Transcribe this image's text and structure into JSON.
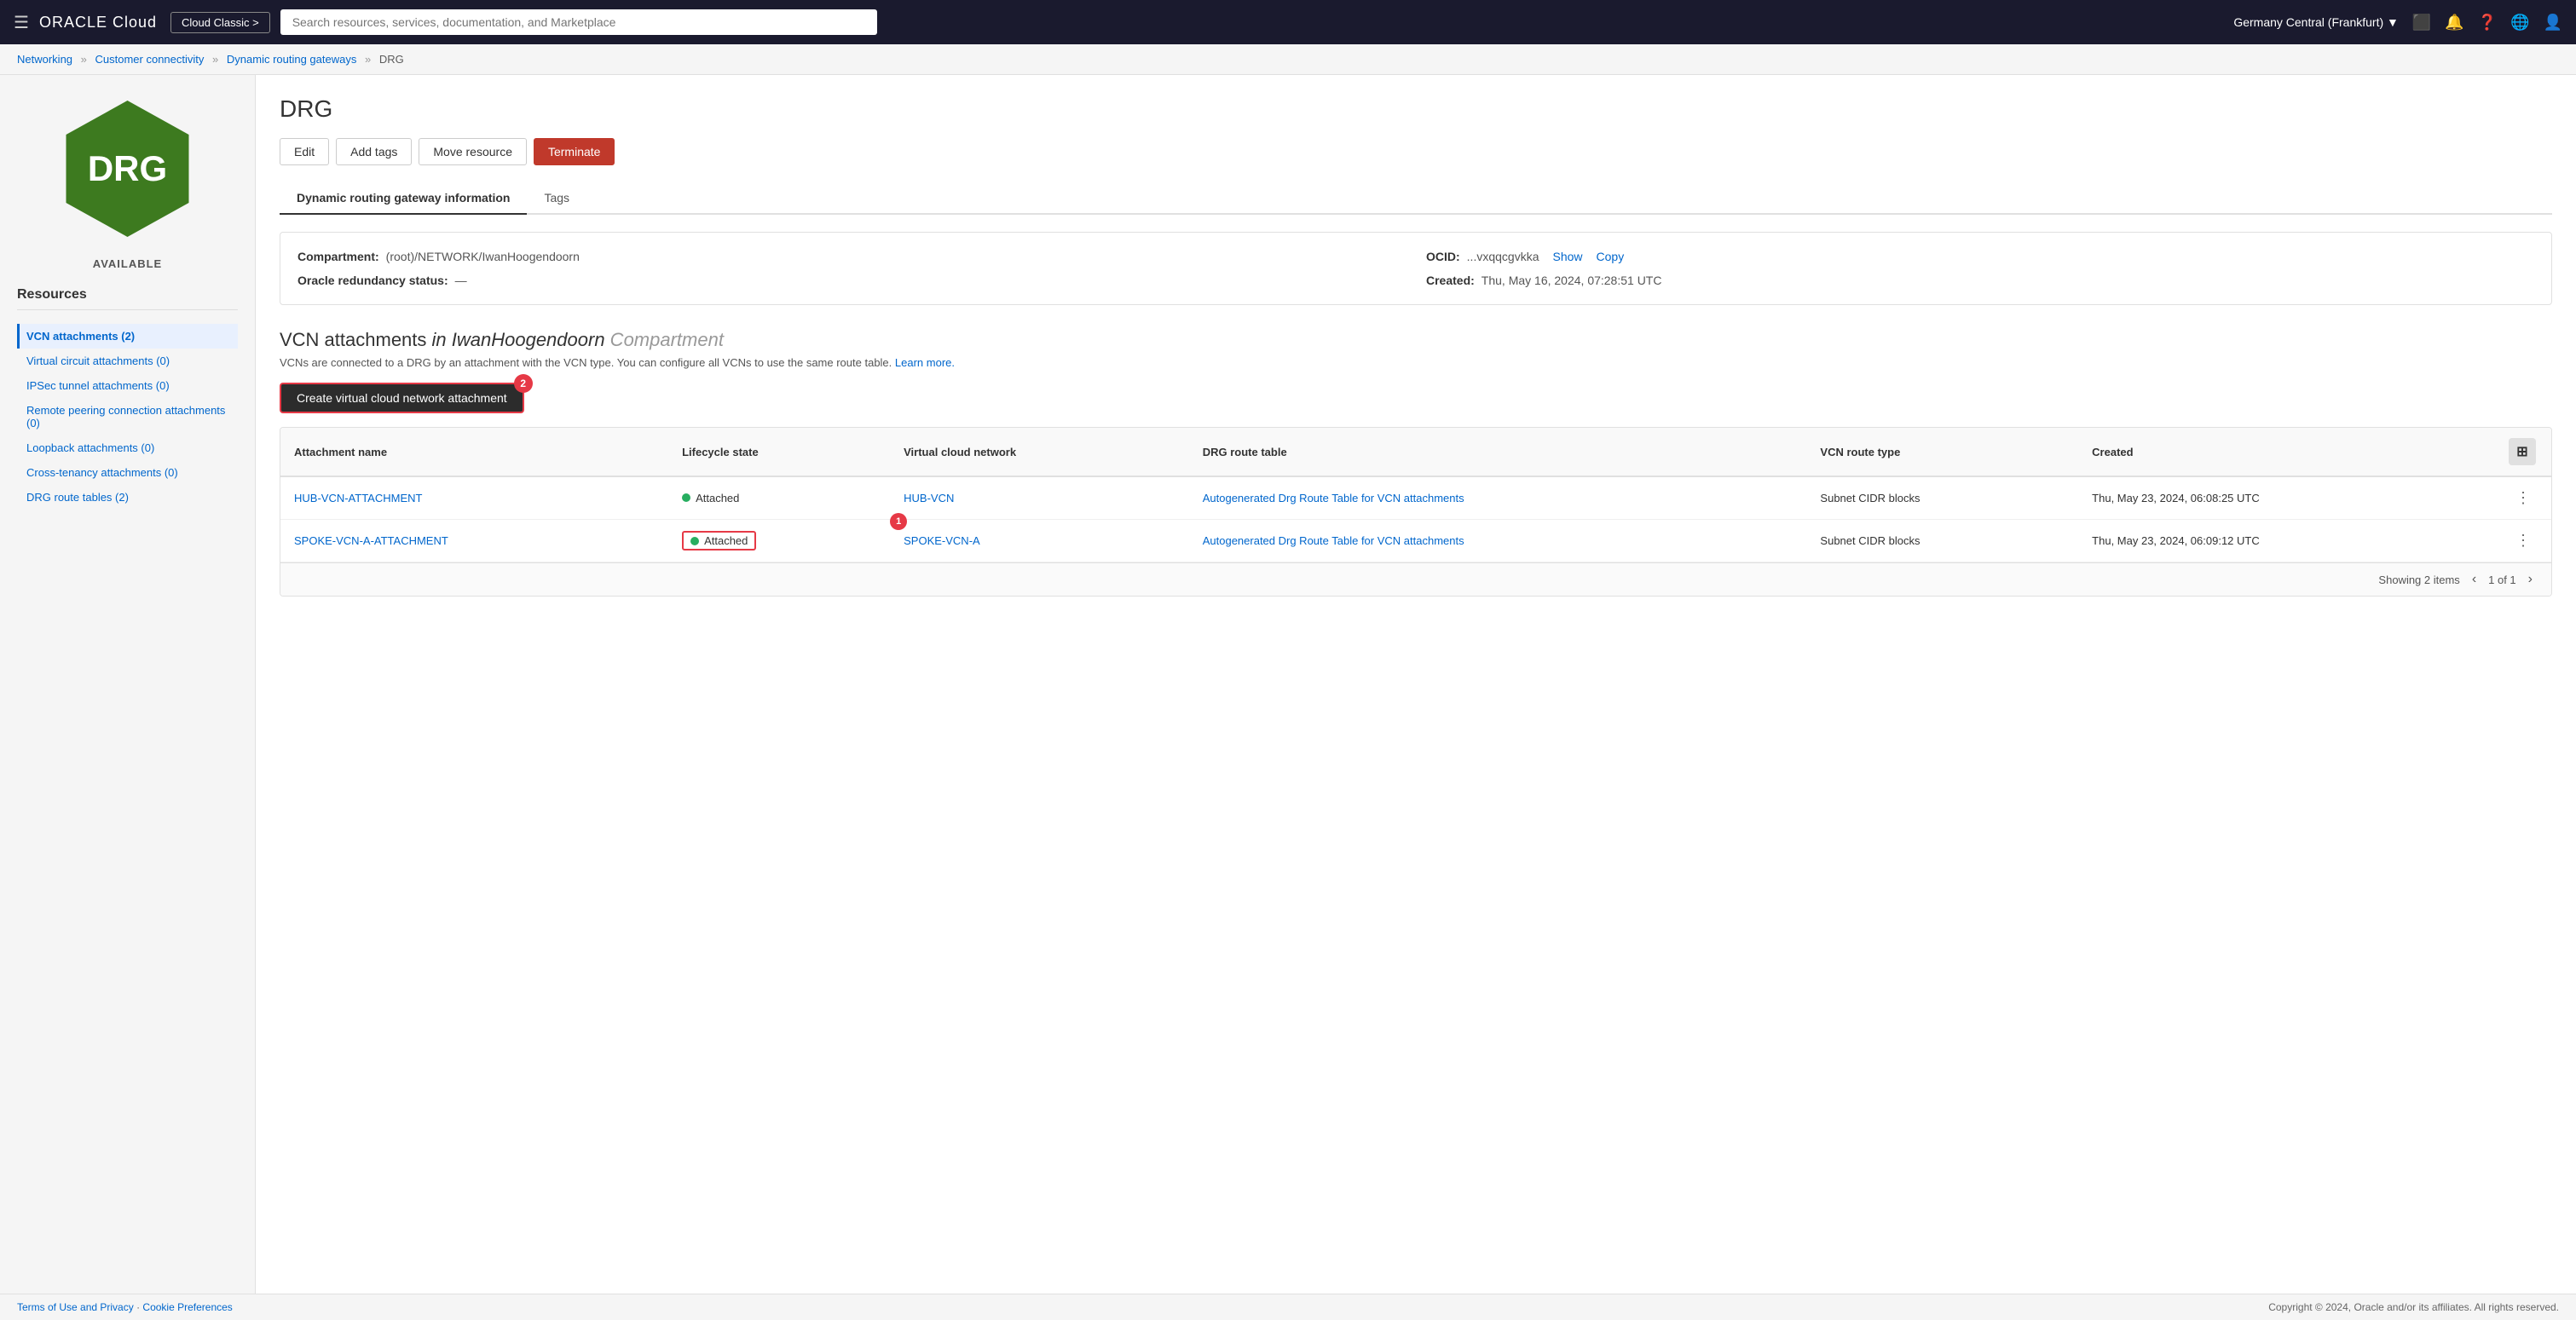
{
  "nav": {
    "hamburger": "☰",
    "logo_oracle": "ORACLE",
    "logo_cloud": " Cloud",
    "cloud_classic_label": "Cloud Classic >",
    "search_placeholder": "Search resources, services, documentation, and Marketplace",
    "region": "Germany Central (Frankfurt)",
    "region_arrow": "▼"
  },
  "breadcrumb": {
    "networking": "Networking",
    "customer_connectivity": "Customer connectivity",
    "dynamic_routing_gateways": "Dynamic routing gateways",
    "current": "DRG"
  },
  "left_panel": {
    "icon_text": "DRG",
    "status_label": "AVAILABLE",
    "resources_title": "Resources",
    "sidebar_items": [
      {
        "label": "VCN attachments (2)",
        "active": true
      },
      {
        "label": "Virtual circuit attachments (0)",
        "active": false
      },
      {
        "label": "IPSec tunnel attachments (0)",
        "active": false
      },
      {
        "label": "Remote peering connection attachments (0)",
        "active": false
      },
      {
        "label": "Loopback attachments (0)",
        "active": false
      },
      {
        "label": "Cross-tenancy attachments (0)",
        "active": false
      },
      {
        "label": "DRG route tables (2)",
        "active": false
      }
    ]
  },
  "content": {
    "page_title": "DRG",
    "buttons": {
      "edit": "Edit",
      "add_tags": "Add tags",
      "move_resource": "Move resource",
      "terminate": "Terminate"
    },
    "tabs": [
      {
        "label": "Dynamic routing gateway information",
        "active": true
      },
      {
        "label": "Tags",
        "active": false
      }
    ],
    "info": {
      "compartment_label": "Compartment:",
      "compartment_value": "(root)/NETWORK/IwanHoogendoorn",
      "ocid_label": "OCID:",
      "ocid_value": "...vxqqcgvkka",
      "ocid_show": "Show",
      "ocid_copy": "Copy",
      "redundancy_label": "Oracle redundancy status:",
      "redundancy_value": "—",
      "created_label": "Created:",
      "created_value": "Thu, May 16, 2024, 07:28:51 UTC"
    },
    "vcn_section": {
      "title_prefix": "VCN attachments ",
      "title_em": "in IwanHoogendoorn",
      "title_suffix": " Compartment",
      "description": "VCNs are connected to a DRG by an attachment with the VCN type. You can configure all VCNs to use the same route table.",
      "learn_more": "Learn more.",
      "create_button": "Create virtual cloud network attachment",
      "create_badge": "2",
      "table": {
        "columns": [
          "Attachment name",
          "Lifecycle state",
          "Virtual cloud network",
          "DRG route table",
          "VCN route type",
          "Created"
        ],
        "rows": [
          {
            "attachment_name": "HUB-VCN-ATTACHMENT",
            "lifecycle_state": "Attached",
            "vcn": "HUB-VCN",
            "drg_route_table": "Autogenerated Drg Route Table for VCN attachments",
            "vcn_route_type": "Subnet CIDR blocks",
            "created": "Thu, May 23, 2024, 06:08:25 UTC",
            "highlighted": false
          },
          {
            "attachment_name": "SPOKE-VCN-A-ATTACHMENT",
            "lifecycle_state": "Attached",
            "vcn": "SPOKE-VCN-A",
            "drg_route_table": "Autogenerated Drg Route Table for VCN attachments",
            "vcn_route_type": "Subnet CIDR blocks",
            "created": "Thu, May 23, 2024, 06:09:12 UTC",
            "highlighted": true
          }
        ],
        "showing": "Showing 2 items",
        "pagination": "1 of 1"
      }
    }
  },
  "footer": {
    "terms": "Terms of Use and Privacy",
    "cookie": "Cookie Preferences",
    "copyright": "Copyright © 2024, Oracle and/or its affiliates. All rights reserved."
  }
}
